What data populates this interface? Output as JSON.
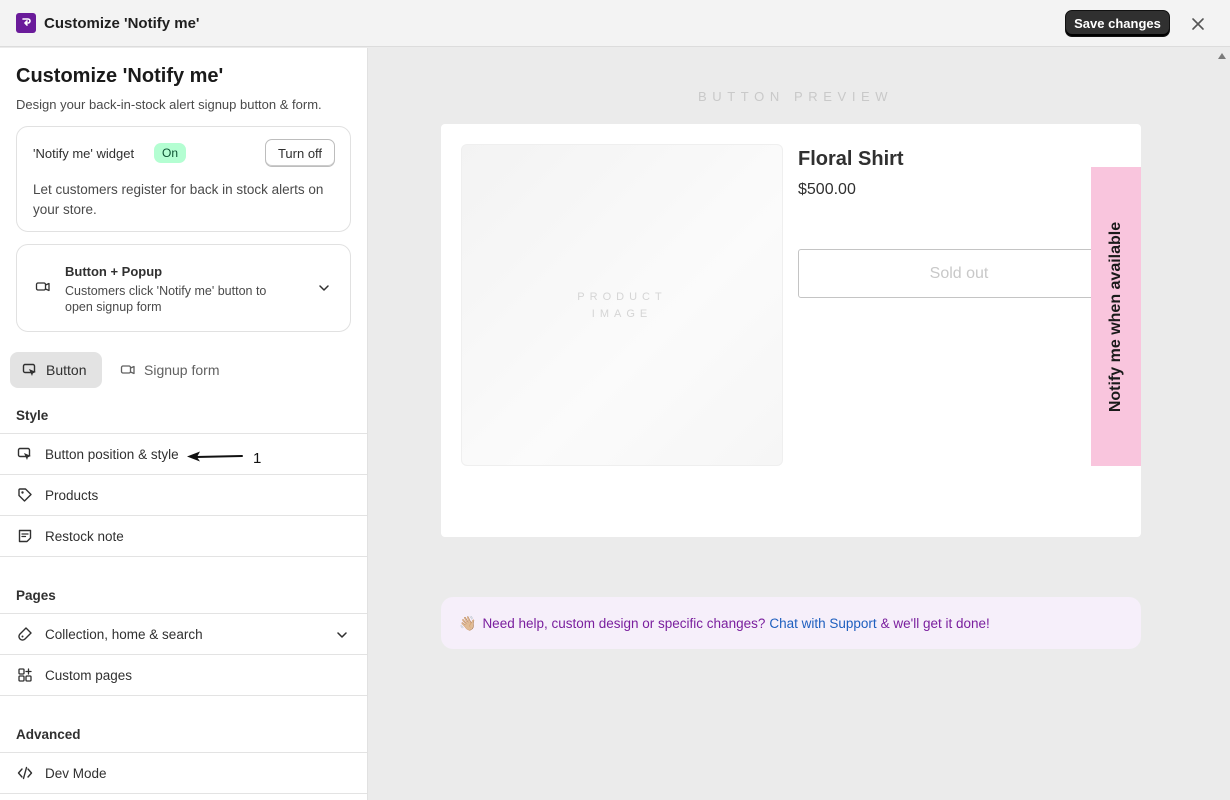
{
  "window": {
    "title": "Customize 'Notify me'",
    "save_label": "Save changes"
  },
  "sidebar": {
    "title": "Customize 'Notify me'",
    "subtitle": "Design your back-in-stock alert signup button & form.",
    "widget": {
      "label": "'Notify me' widget",
      "status": "On",
      "toggle_label": "Turn off",
      "description": "Let customers register for back in stock alerts on your store."
    },
    "mode": {
      "title": "Button + Popup",
      "description": "Customers click 'Notify me' button to open signup form"
    },
    "tabs": [
      {
        "label": "Button",
        "active": true
      },
      {
        "label": "Signup form",
        "active": false
      }
    ],
    "sections": {
      "style": {
        "heading": "Style",
        "items": [
          {
            "label": "Button position & style",
            "icon": "cursor-click-icon"
          },
          {
            "label": "Products",
            "icon": "tag-icon"
          },
          {
            "label": "Restock note",
            "icon": "note-icon"
          }
        ]
      },
      "pages": {
        "heading": "Pages",
        "items": [
          {
            "label": "Collection, home & search",
            "icon": "paint-brush-icon"
          },
          {
            "label": "Custom pages",
            "icon": "apps-icon"
          }
        ]
      },
      "advanced": {
        "heading": "Advanced",
        "items": [
          {
            "label": "Dev Mode",
            "icon": "code-icon"
          }
        ]
      }
    },
    "annotation": {
      "number": "1"
    }
  },
  "preview": {
    "label": "BUTTON PREVIEW",
    "product": {
      "image_placeholder_line1": "PRODUCT",
      "image_placeholder_line2": "IMAGE",
      "name": "Floral Shirt",
      "price": "$500.00",
      "soldout_label": "Sold out"
    },
    "notify_button": "Notify me when available",
    "notify_color": "#f9c5dd"
  },
  "help": {
    "emoji": "👋🏼",
    "text_before": "Need help, custom design or specific changes?",
    "link": "Chat with Support",
    "text_after": "& we'll get it done!"
  },
  "colors": {
    "accent": "#303030",
    "brand": "#6a1b9a",
    "status_on_bg": "#b4fed2",
    "help_text": "#7a1f9e",
    "help_link": "#1e5fbf"
  }
}
